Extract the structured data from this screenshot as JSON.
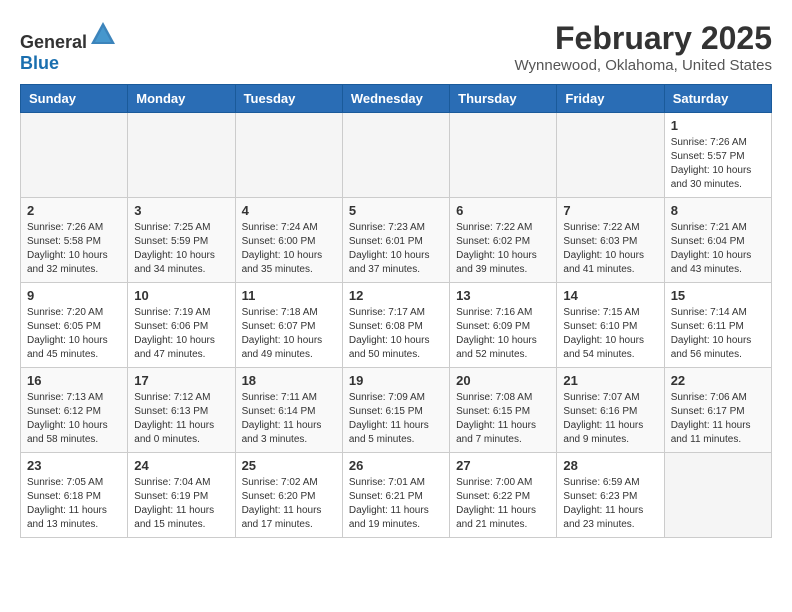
{
  "header": {
    "logo_general": "General",
    "logo_blue": "Blue",
    "month_year": "February 2025",
    "location": "Wynnewood, Oklahoma, United States"
  },
  "weekdays": [
    "Sunday",
    "Monday",
    "Tuesday",
    "Wednesday",
    "Thursday",
    "Friday",
    "Saturday"
  ],
  "weeks": [
    [
      {
        "day": "",
        "info": "",
        "empty": true
      },
      {
        "day": "",
        "info": "",
        "empty": true
      },
      {
        "day": "",
        "info": "",
        "empty": true
      },
      {
        "day": "",
        "info": "",
        "empty": true
      },
      {
        "day": "",
        "info": "",
        "empty": true
      },
      {
        "day": "",
        "info": "",
        "empty": true
      },
      {
        "day": "1",
        "info": "Sunrise: 7:26 AM\nSunset: 5:57 PM\nDaylight: 10 hours\nand 30 minutes.",
        "empty": false
      }
    ],
    [
      {
        "day": "2",
        "info": "Sunrise: 7:26 AM\nSunset: 5:58 PM\nDaylight: 10 hours\nand 32 minutes.",
        "empty": false
      },
      {
        "day": "3",
        "info": "Sunrise: 7:25 AM\nSunset: 5:59 PM\nDaylight: 10 hours\nand 34 minutes.",
        "empty": false
      },
      {
        "day": "4",
        "info": "Sunrise: 7:24 AM\nSunset: 6:00 PM\nDaylight: 10 hours\nand 35 minutes.",
        "empty": false
      },
      {
        "day": "5",
        "info": "Sunrise: 7:23 AM\nSunset: 6:01 PM\nDaylight: 10 hours\nand 37 minutes.",
        "empty": false
      },
      {
        "day": "6",
        "info": "Sunrise: 7:22 AM\nSunset: 6:02 PM\nDaylight: 10 hours\nand 39 minutes.",
        "empty": false
      },
      {
        "day": "7",
        "info": "Sunrise: 7:22 AM\nSunset: 6:03 PM\nDaylight: 10 hours\nand 41 minutes.",
        "empty": false
      },
      {
        "day": "8",
        "info": "Sunrise: 7:21 AM\nSunset: 6:04 PM\nDaylight: 10 hours\nand 43 minutes.",
        "empty": false
      }
    ],
    [
      {
        "day": "9",
        "info": "Sunrise: 7:20 AM\nSunset: 6:05 PM\nDaylight: 10 hours\nand 45 minutes.",
        "empty": false
      },
      {
        "day": "10",
        "info": "Sunrise: 7:19 AM\nSunset: 6:06 PM\nDaylight: 10 hours\nand 47 minutes.",
        "empty": false
      },
      {
        "day": "11",
        "info": "Sunrise: 7:18 AM\nSunset: 6:07 PM\nDaylight: 10 hours\nand 49 minutes.",
        "empty": false
      },
      {
        "day": "12",
        "info": "Sunrise: 7:17 AM\nSunset: 6:08 PM\nDaylight: 10 hours\nand 50 minutes.",
        "empty": false
      },
      {
        "day": "13",
        "info": "Sunrise: 7:16 AM\nSunset: 6:09 PM\nDaylight: 10 hours\nand 52 minutes.",
        "empty": false
      },
      {
        "day": "14",
        "info": "Sunrise: 7:15 AM\nSunset: 6:10 PM\nDaylight: 10 hours\nand 54 minutes.",
        "empty": false
      },
      {
        "day": "15",
        "info": "Sunrise: 7:14 AM\nSunset: 6:11 PM\nDaylight: 10 hours\nand 56 minutes.",
        "empty": false
      }
    ],
    [
      {
        "day": "16",
        "info": "Sunrise: 7:13 AM\nSunset: 6:12 PM\nDaylight: 10 hours\nand 58 minutes.",
        "empty": false
      },
      {
        "day": "17",
        "info": "Sunrise: 7:12 AM\nSunset: 6:13 PM\nDaylight: 11 hours\nand 0 minutes.",
        "empty": false
      },
      {
        "day": "18",
        "info": "Sunrise: 7:11 AM\nSunset: 6:14 PM\nDaylight: 11 hours\nand 3 minutes.",
        "empty": false
      },
      {
        "day": "19",
        "info": "Sunrise: 7:09 AM\nSunset: 6:15 PM\nDaylight: 11 hours\nand 5 minutes.",
        "empty": false
      },
      {
        "day": "20",
        "info": "Sunrise: 7:08 AM\nSunset: 6:15 PM\nDaylight: 11 hours\nand 7 minutes.",
        "empty": false
      },
      {
        "day": "21",
        "info": "Sunrise: 7:07 AM\nSunset: 6:16 PM\nDaylight: 11 hours\nand 9 minutes.",
        "empty": false
      },
      {
        "day": "22",
        "info": "Sunrise: 7:06 AM\nSunset: 6:17 PM\nDaylight: 11 hours\nand 11 minutes.",
        "empty": false
      }
    ],
    [
      {
        "day": "23",
        "info": "Sunrise: 7:05 AM\nSunset: 6:18 PM\nDaylight: 11 hours\nand 13 minutes.",
        "empty": false
      },
      {
        "day": "24",
        "info": "Sunrise: 7:04 AM\nSunset: 6:19 PM\nDaylight: 11 hours\nand 15 minutes.",
        "empty": false
      },
      {
        "day": "25",
        "info": "Sunrise: 7:02 AM\nSunset: 6:20 PM\nDaylight: 11 hours\nand 17 minutes.",
        "empty": false
      },
      {
        "day": "26",
        "info": "Sunrise: 7:01 AM\nSunset: 6:21 PM\nDaylight: 11 hours\nand 19 minutes.",
        "empty": false
      },
      {
        "day": "27",
        "info": "Sunrise: 7:00 AM\nSunset: 6:22 PM\nDaylight: 11 hours\nand 21 minutes.",
        "empty": false
      },
      {
        "day": "28",
        "info": "Sunrise: 6:59 AM\nSunset: 6:23 PM\nDaylight: 11 hours\nand 23 minutes.",
        "empty": false
      },
      {
        "day": "",
        "info": "",
        "empty": true
      }
    ]
  ]
}
